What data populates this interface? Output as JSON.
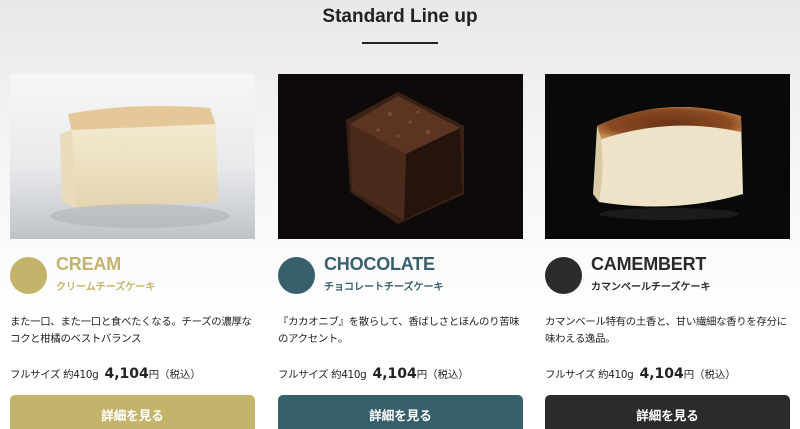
{
  "section": {
    "title": "Standard Line up"
  },
  "products": [
    {
      "name": "CREAM",
      "subtitle": "クリームチーズケーキ",
      "description": "また一口、また一口と食べたくなる。チーズの濃厚なコクと柑橘のベストバランス",
      "size_label": "フルサイズ 約410g",
      "price": "4,104",
      "price_suffix": "円（税込）",
      "button": "詳細を見る",
      "accent": "#c4b36a",
      "image": "cream-cheesecake-photo"
    },
    {
      "name": "CHOCOLATE",
      "subtitle": "チョコレートチーズケーキ",
      "description": "『カカオニブ』を散らして、香ばしさとほんのり苦味のアクセント。",
      "size_label": "フルサイズ 約410g",
      "price": "4,104",
      "price_suffix": "円（税込）",
      "button": "詳細を見る",
      "accent": "#36606b",
      "image": "chocolate-cheesecake-photo"
    },
    {
      "name": "CAMEMBERT",
      "subtitle": "カマンベールチーズケーキ",
      "description": "カマンベール特有の土香と、甘い繊細な香りを存分に味わえる逸品。",
      "size_label": "フルサイズ 約410g",
      "price": "4,104",
      "price_suffix": "円（税込）",
      "button": "詳細を見る",
      "accent": "#2b2b2b",
      "image": "camembert-cheesecake-photo"
    }
  ]
}
